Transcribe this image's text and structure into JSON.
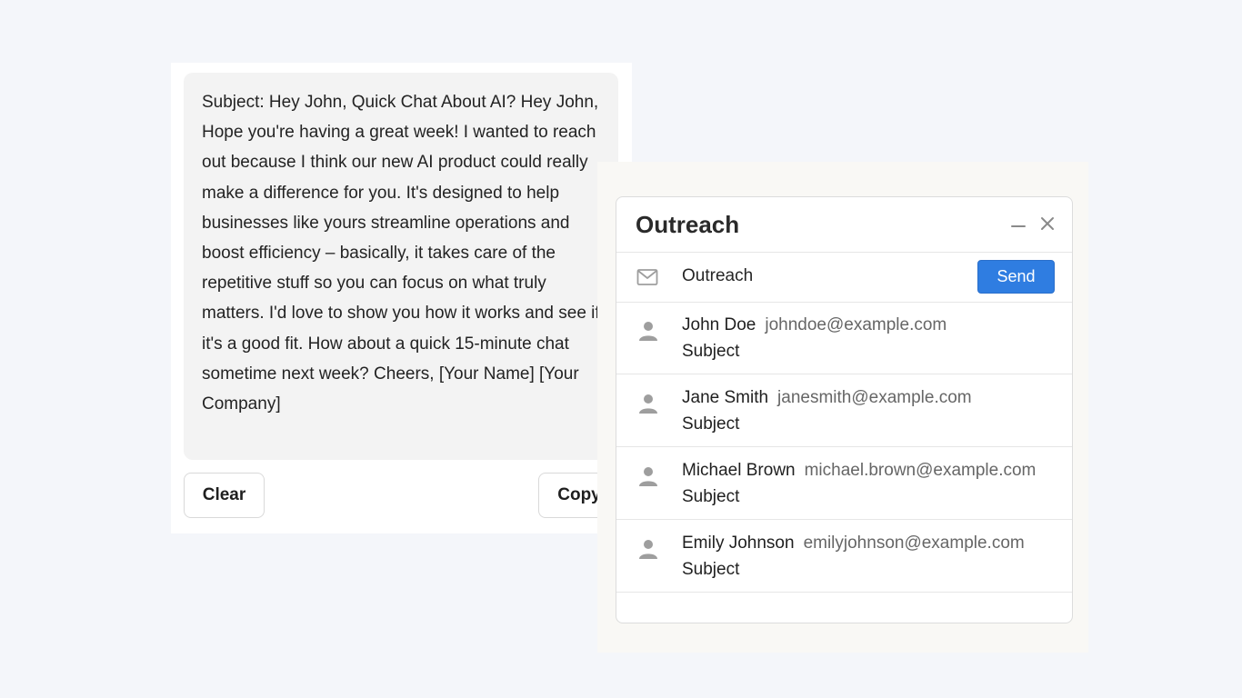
{
  "generator": {
    "email_text": "Subject: Hey John, Quick Chat About AI? Hey John, Hope you're having a great week! I wanted to reach out because I think our new AI product could really make a difference for you. It's designed to help businesses like yours streamline operations and boost efficiency – basically, it takes care of the repetitive stuff so you can focus on what truly matters. I'd love to show you how it works and see if it's a good fit. How about a quick 15-minute chat sometime next week? Cheers, [Your Name] [Your Company]",
    "clear_label": "Clear",
    "copy_label": "Copy"
  },
  "outreach": {
    "title": "Outreach",
    "compose_label": "Outreach",
    "send_label": "Send",
    "icons": {
      "minimize": "minimize-icon",
      "close": "close-icon",
      "mail": "mail-icon",
      "person": "person-icon"
    },
    "colors": {
      "send_button": "#2f7de1",
      "icon_gray": "#9e9e9e"
    },
    "contacts": [
      {
        "name": "John Doe",
        "email": "johndoe@example.com",
        "subject": "Subject"
      },
      {
        "name": "Jane Smith",
        "email": "janesmith@example.com",
        "subject": "Subject"
      },
      {
        "name": "Michael Brown",
        "email": "michael.brown@example.com",
        "subject": "Subject"
      },
      {
        "name": "Emily Johnson",
        "email": "emilyjohnson@example.com",
        "subject": "Subject"
      }
    ]
  }
}
